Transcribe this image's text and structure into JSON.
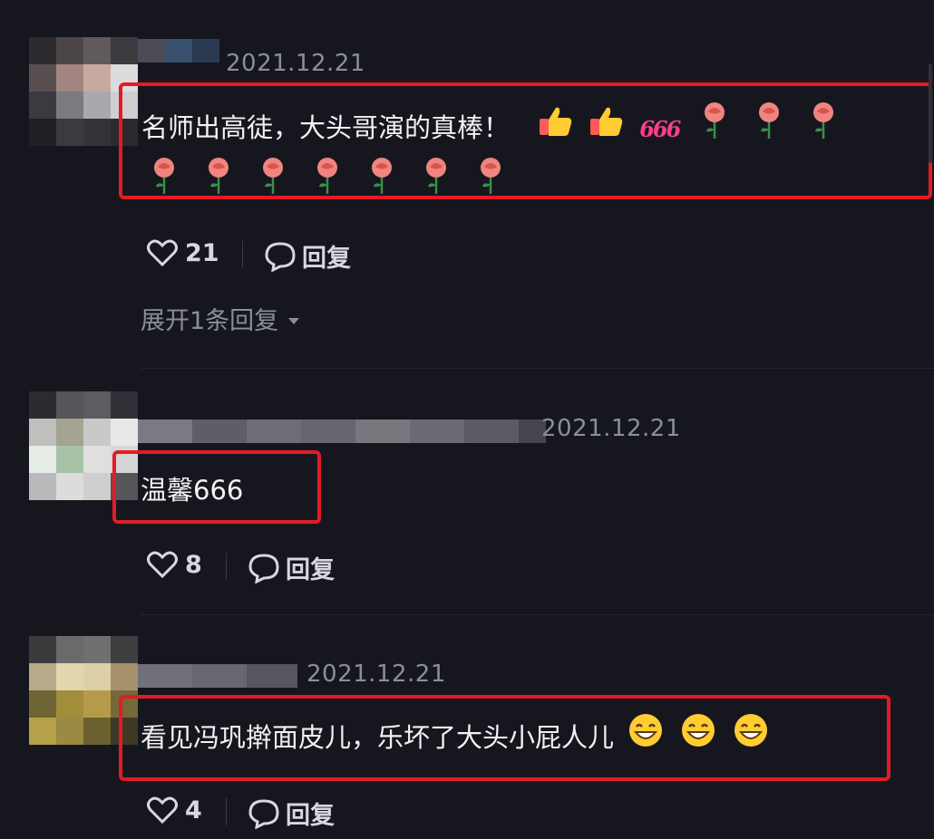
{
  "colors": {
    "background": "#16171e",
    "highlight_border": "#e41b24",
    "meta_text": "#8c8e96"
  },
  "comments": [
    {
      "date": "2021.12.21",
      "text": "名师出高徒，大头哥演的真棒！",
      "emojis": [
        "thumbs-up-icon",
        "thumbs-up-icon",
        "666-sticker",
        "rose-icon",
        "rose-icon",
        "rose-icon",
        "rose-icon",
        "rose-icon",
        "rose-icon",
        "rose-icon",
        "rose-icon",
        "rose-icon",
        "rose-icon"
      ],
      "sticker_666": "666",
      "likes": "21",
      "reply_label": "回复",
      "expand_label": "展开1条回复"
    },
    {
      "date": "2021.12.21",
      "text": "温馨666",
      "likes": "8",
      "reply_label": "回复"
    },
    {
      "date": "2021.12.21",
      "text": "看见冯巩擀面皮儿，乐坏了大头小屁人儿",
      "emojis": [
        "grin-icon",
        "grin-icon",
        "grin-icon"
      ],
      "likes": "4",
      "reply_label": "回复"
    }
  ]
}
